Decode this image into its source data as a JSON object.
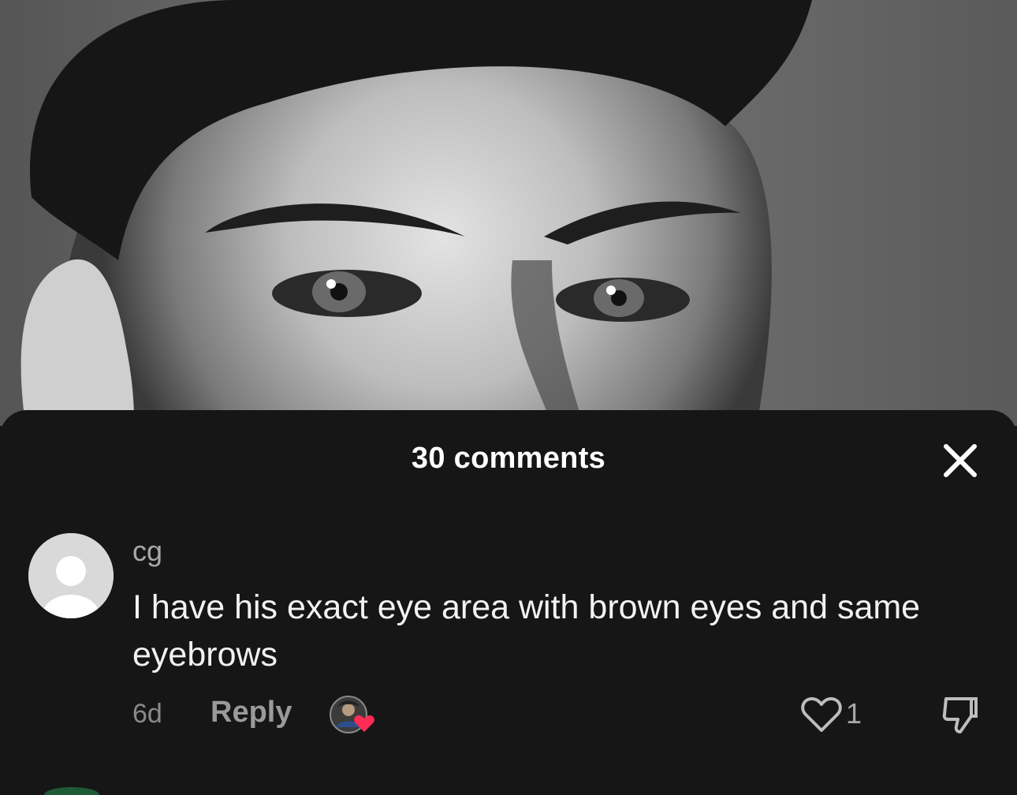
{
  "background": {
    "image_description_icon": "portrait-photo"
  },
  "sheet": {
    "title": "30 comments",
    "close_icon": "close-icon"
  },
  "comments": [
    {
      "username": "cg",
      "text": "I have his exact eye area with brown eyes and same eyebrows",
      "time": "6d",
      "reply_label": "Reply",
      "like_count": "1",
      "liked_by_creator": true
    }
  ],
  "colors": {
    "sheet_bg": "#161616",
    "heart_accent": "#fe2c55",
    "text_primary": "#f2f2f2",
    "text_secondary": "#a8a8a8"
  }
}
